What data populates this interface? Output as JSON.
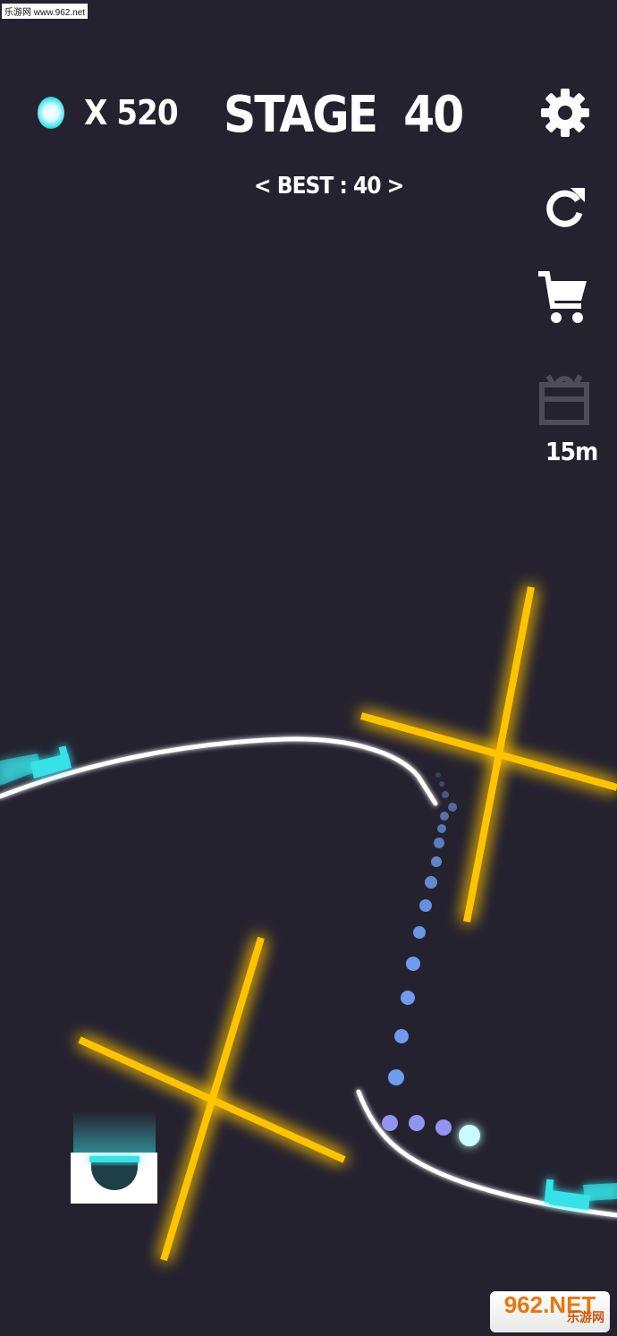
{
  "watermark_top": "乐游网 www.962.net",
  "hud": {
    "gem_count": "X 520",
    "stage_label": "STAGE",
    "stage_number": "40",
    "best": "< BEST : 40 >"
  },
  "side_menu": {
    "settings_icon": "gear-icon",
    "restart_icon": "restart-icon",
    "shop_icon": "cart-icon",
    "gift_icon": "gift-icon",
    "gift_timer": "15m"
  },
  "watermark_bottom": {
    "main": "962.NET",
    "sub": "乐游网"
  },
  "colors": {
    "background": "#25222f",
    "laser": "#ffc400",
    "cyan": "#35e2e8",
    "track": "#ffffff",
    "trail": "#6f7fe8"
  }
}
